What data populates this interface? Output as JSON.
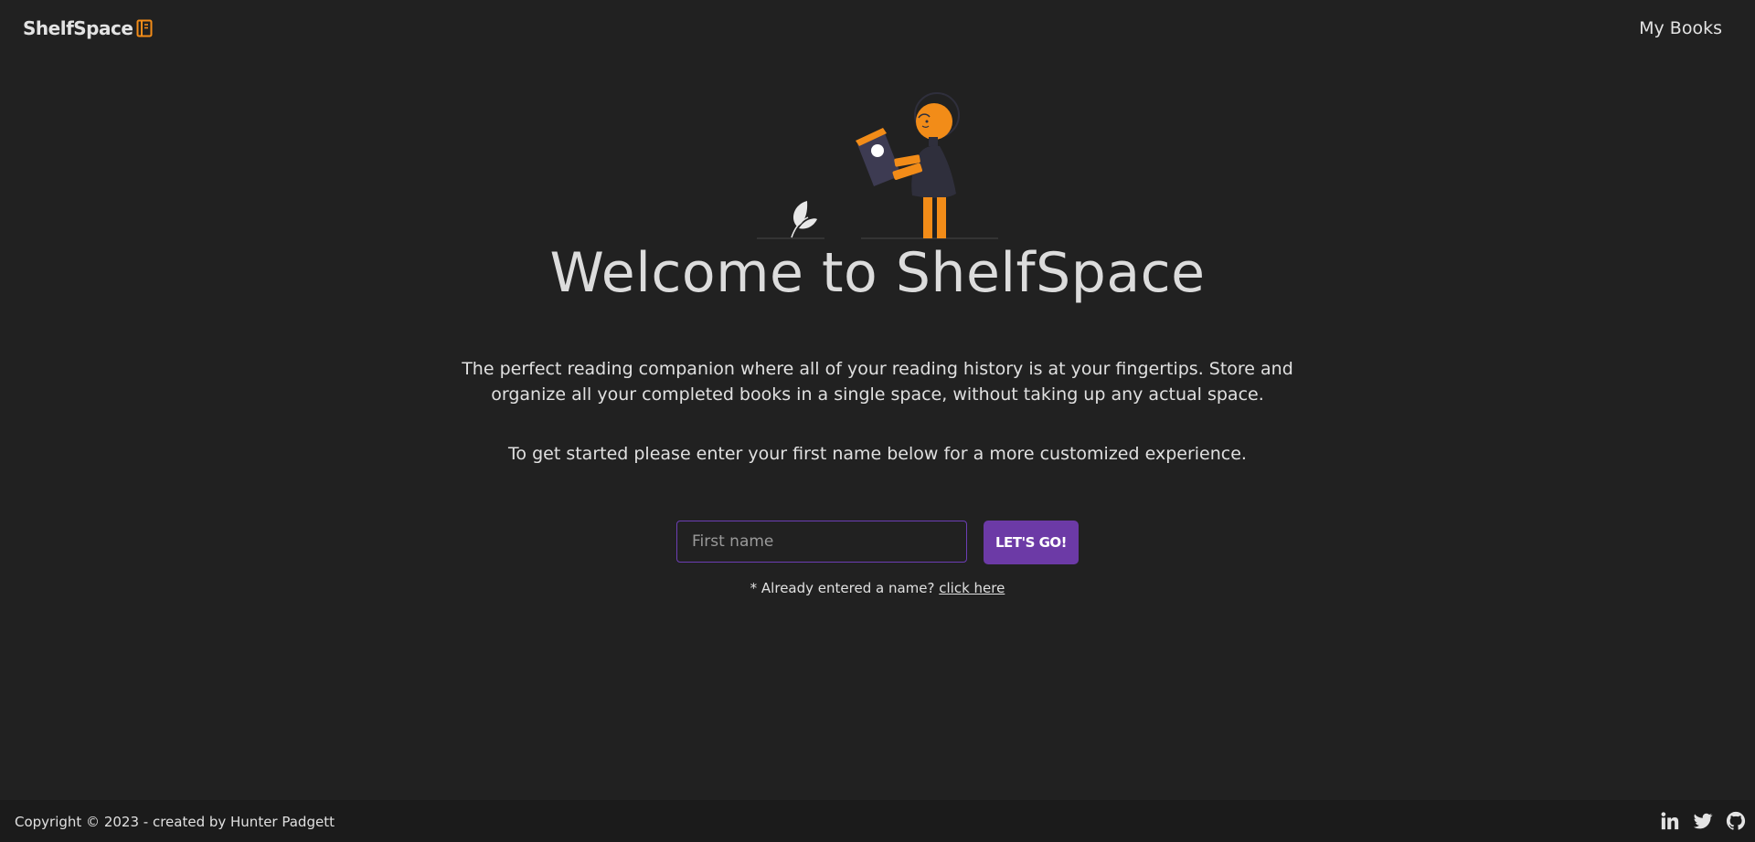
{
  "header": {
    "brand": "ShelfSpace",
    "brand_icon": "book-icon",
    "nav_link": "My Books"
  },
  "hero": {
    "illustration": "person-reading-book-illustration",
    "title": "Welcome to ShelfSpace",
    "description": "The perfect reading companion where all of your reading history is at your fingertips. Store and organize all your completed books in a single space, without taking up any actual space.",
    "instruction": "To get started please enter your first name below for a more customized experience."
  },
  "form": {
    "name_placeholder": "First name",
    "name_value": "",
    "submit_label": "LET'S GO!",
    "helper_text": "* Already entered a name?",
    "helper_link": "click here"
  },
  "footer": {
    "copyright": "Copyright © 2023 - created by Hunter Padgett",
    "socials": [
      "linkedin-icon",
      "twitter-icon",
      "github-icon"
    ]
  },
  "colors": {
    "background": "#212121",
    "footer_background": "#1b1b1b",
    "accent_orange": "#f28c18",
    "accent_purple": "#6c3aa6",
    "text": "#e3e3e3"
  }
}
